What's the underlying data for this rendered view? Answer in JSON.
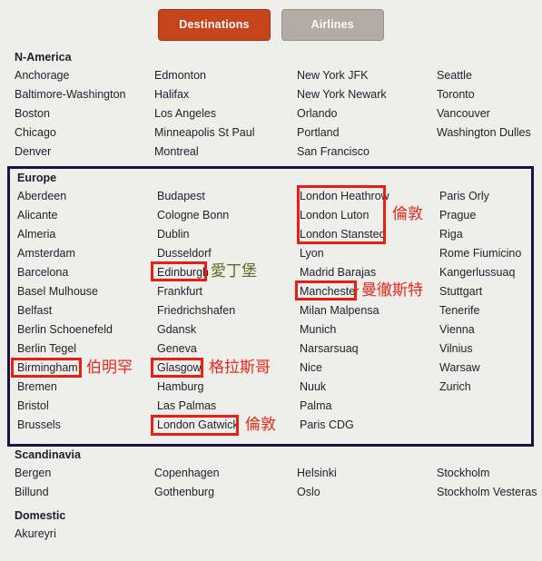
{
  "page": {
    "background_color": "#eeeeea",
    "text_color": "#22222e"
  },
  "tabs": [
    {
      "label": "Destinations",
      "state": "active",
      "color": "#c6441c"
    },
    {
      "label": "Airlines",
      "state": "inactive",
      "color": "#b4aca4"
    }
  ],
  "regions": [
    {
      "title": "N-America",
      "columns": [
        [
          "Anchorage",
          "Baltimore-Washington",
          "Boston",
          "Chicago",
          "Denver"
        ],
        [
          "Edmonton",
          "Halifax",
          "Los Angeles",
          "Minneapolis St Paul",
          "Montreal"
        ],
        [
          "New York JFK",
          "New York Newark",
          "Orlando",
          "Portland",
          "San Francisco"
        ],
        [
          "Seattle",
          "Toronto",
          "Vancouver",
          "Washington Dulles"
        ]
      ]
    },
    {
      "title": "Europe",
      "highlighted": true,
      "border_color": "#151442",
      "columns": [
        [
          "Aberdeen",
          "Alicante",
          "Almeria",
          "Amsterdam",
          "Barcelona",
          "Basel Mulhouse",
          "Belfast",
          "Berlin Schoenefeld",
          "Berlin Tegel",
          "Birmingham",
          "Bremen",
          "Bristol",
          "Brussels"
        ],
        [
          "Budapest",
          "Cologne Bonn",
          "Dublin",
          "Dusseldorf",
          "Edinburgh",
          "Frankfurt",
          "Friedrichshafen",
          "Gdansk",
          "Geneva",
          "Glasgow",
          "Hamburg",
          "Las Palmas",
          "London Gatwick"
        ],
        [
          "London Heathrow",
          "London Luton",
          "London Stansted",
          "Lyon",
          "Madrid Barajas",
          "Manchester",
          "Milan Malpensa",
          "Munich",
          "Narsarsuaq",
          "Nice",
          "Nuuk",
          "Palma",
          "Paris CDG"
        ],
        [
          "Paris Orly",
          "Prague",
          "Riga",
          "Rome Fiumicino",
          "Kangerlussuaq",
          "Stuttgart",
          "Tenerife",
          "Vienna",
          "Vilnius",
          "Warsaw",
          "Zurich"
        ]
      ]
    },
    {
      "title": "Scandinavia",
      "columns": [
        [
          "Bergen",
          "Billund"
        ],
        [
          "Copenhagen",
          "Gothenburg"
        ],
        [
          "Helsinki",
          "Oslo"
        ],
        [
          "Stockholm",
          "Stockholm Vesteras"
        ]
      ]
    },
    {
      "title": "Domestic",
      "columns": [
        [
          "Akureyri"
        ],
        [],
        [],
        []
      ]
    }
  ],
  "annotations": {
    "box_color": "#e81f12",
    "items": [
      {
        "target": "London Heathrow / London Luton / London Stansted",
        "text": "倫敦",
        "color": "#e8281c"
      },
      {
        "target": "Edinburgh",
        "text": "愛丁堡",
        "color": "#5d6b26"
      },
      {
        "target": "Manchester",
        "text": "曼徹斯特",
        "color": "#e8281c"
      },
      {
        "target": "Birmingham",
        "text": "伯明罕",
        "color": "#e8281c"
      },
      {
        "target": "Glasgow",
        "text": "格拉斯哥",
        "color": "#e8281c"
      },
      {
        "target": "London Gatwick",
        "text": "倫敦",
        "color": "#e8281c"
      }
    ]
  }
}
